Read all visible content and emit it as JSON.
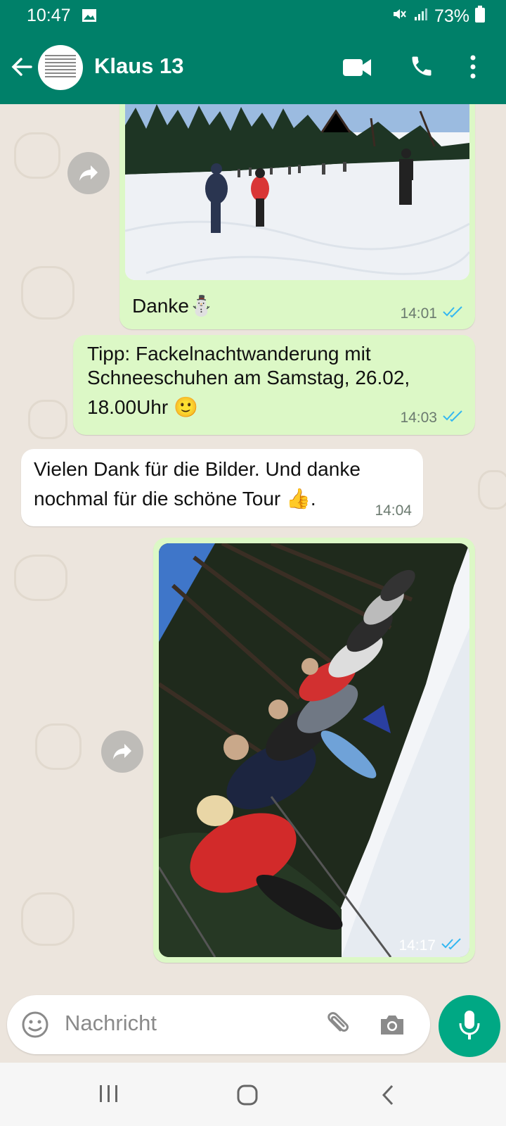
{
  "status_bar": {
    "time": "10:47",
    "battery": "73%"
  },
  "header": {
    "contact_name": "Klaus 13"
  },
  "messages": [
    {
      "id": "m1",
      "type": "photo_caption",
      "caption": "Danke⛄",
      "time": "14:01"
    },
    {
      "id": "m2",
      "type": "text",
      "text_line1": "Tipp: Fackelnachtwanderung mit",
      "text_line2": "Schneeschuhen am Samstag, 26.02,",
      "text_line3": "18.00Uhr 🙂",
      "time": "14:03"
    },
    {
      "id": "m3",
      "type": "text_in",
      "text_line1": "Vielen Dank für die Bilder. Und danke",
      "text_line2": "nochmal für die schöne Tour 👍.",
      "time": "14:04"
    },
    {
      "id": "m4",
      "type": "photo",
      "time": "14:17"
    }
  ],
  "input": {
    "placeholder": "Nachricht"
  },
  "colors": {
    "header": "#008069",
    "outgoing": "#dcf8c6",
    "incoming": "#ffffff",
    "read_ticks": "#34b7f1",
    "mic": "#00a884"
  },
  "icons": [
    "gallery-icon",
    "mute-icon",
    "signal-icon",
    "battery-icon",
    "back-arrow-icon",
    "video-call-icon",
    "phone-icon",
    "more-icon",
    "forward-icon",
    "double-check-icon",
    "emoji-icon",
    "attach-icon",
    "camera-icon",
    "mic-icon",
    "recents-icon",
    "home-icon",
    "nav-back-icon"
  ]
}
